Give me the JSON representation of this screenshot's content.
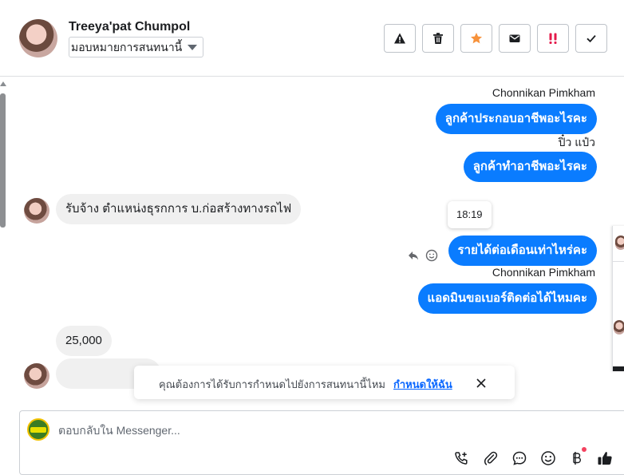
{
  "header": {
    "contact_name": "Treeya'pat Chumpol",
    "assign_select_value": "มอบหมายการสนทนานี้",
    "toolbar": [
      {
        "name": "report-spam-button",
        "icon": "warning-icon"
      },
      {
        "name": "delete-button",
        "icon": "trash-icon"
      },
      {
        "name": "star-button",
        "icon": "star-icon"
      },
      {
        "name": "mark-unread-button",
        "icon": "envelope-icon"
      },
      {
        "name": "follow-up-button",
        "icon": "follow-up-icon"
      },
      {
        "name": "mark-done-button",
        "icon": "check-icon"
      }
    ],
    "star_color": "#f7923b",
    "follow_up_color": "#e4194a"
  },
  "messages": {
    "m1_sender": "Chonnikan Pimkham",
    "m1_text": "ลูกค้าประกอบอาชีพอะไรคะ",
    "m2_sender": "ปิ๋ว แป๋ว",
    "m2_text": "ลูกค้าทำอาชีพอะไรคะ",
    "m3_text": "รับจ้าง ตำแหน่งธุรกการ บ.ก่อสร้างทางรถไฟ",
    "m4_time": "18:19",
    "m4_text": "รายได้ต่อเดือนเท่าไหร่คะ",
    "m5_sender": "Chonnikan Pimkham",
    "m5_text": "แอดมินขอเบอร์ติดต่อได้ไหมคะ",
    "m6_text": "25,000",
    "outgoing_color": "#0a7cff",
    "incoming_color": "#f0f0f0"
  },
  "notice": {
    "text": "คุณต้องการได้รับการกำหนดไปยังการสนทนานี้ไหม",
    "link": "กำหนดให้ฉัน"
  },
  "composer": {
    "placeholder": "ตอบกลับใน Messenger...",
    "icons": [
      "add-call-icon",
      "attachment-icon",
      "saved-reply-icon",
      "emoji-icon",
      "payment-icon",
      "like-icon"
    ]
  }
}
